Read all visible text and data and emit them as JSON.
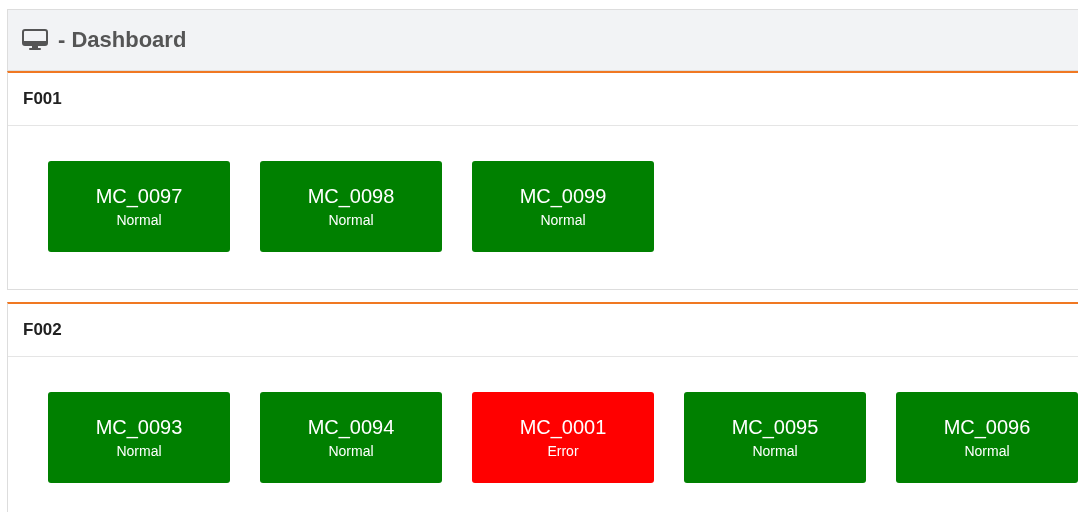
{
  "header": {
    "title": "- Dashboard"
  },
  "sections": [
    {
      "title": "F001",
      "machines": [
        {
          "name": "MC_0097",
          "status": "Normal",
          "color": "#008000"
        },
        {
          "name": "MC_0098",
          "status": "Normal",
          "color": "#008000"
        },
        {
          "name": "MC_0099",
          "status": "Normal",
          "color": "#008000"
        }
      ]
    },
    {
      "title": "F002",
      "machines": [
        {
          "name": "MC_0093",
          "status": "Normal",
          "color": "#008000"
        },
        {
          "name": "MC_0094",
          "status": "Normal",
          "color": "#008000"
        },
        {
          "name": "MC_0001",
          "status": "Error",
          "color": "#ff0000"
        },
        {
          "name": "MC_0095",
          "status": "Normal",
          "color": "#008000"
        },
        {
          "name": "MC_0096",
          "status": "Normal",
          "color": "#008000"
        }
      ]
    }
  ]
}
